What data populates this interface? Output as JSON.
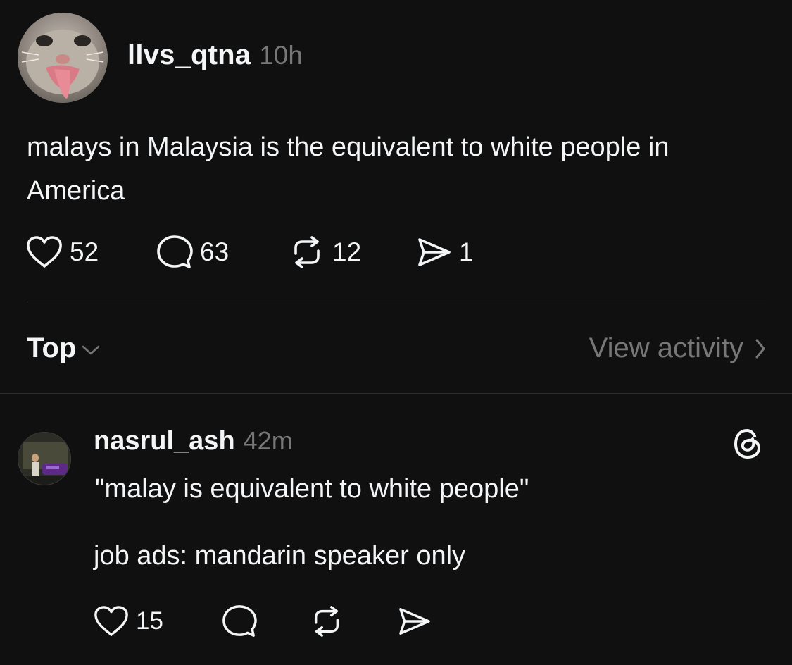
{
  "post": {
    "username": "llvs_qtna",
    "time": "10h",
    "text": "malays in Malaysia is the equivalent to white people in America",
    "likes": "52",
    "comments": "63",
    "reposts": "12",
    "shares": "1"
  },
  "sort": {
    "label": "Top",
    "view_activity": "View activity"
  },
  "reply": {
    "username": "nasrul_ash",
    "time": "42m",
    "line1": "\"malay is equivalent to white people\"",
    "line2": "job ads: mandarin speaker only",
    "likes": "15"
  },
  "icons": {
    "like": "heart-icon",
    "comment": "comment-bubble-icon",
    "repost": "repost-icon",
    "share": "send-icon",
    "sort": "chevron-down-icon",
    "activity": "chevron-right-icon",
    "brand": "threads-logo-icon"
  },
  "colors": {
    "background": "#101010",
    "text": "#f3f5f7",
    "secondary": "#777777",
    "divider": "#2e2e2e"
  }
}
